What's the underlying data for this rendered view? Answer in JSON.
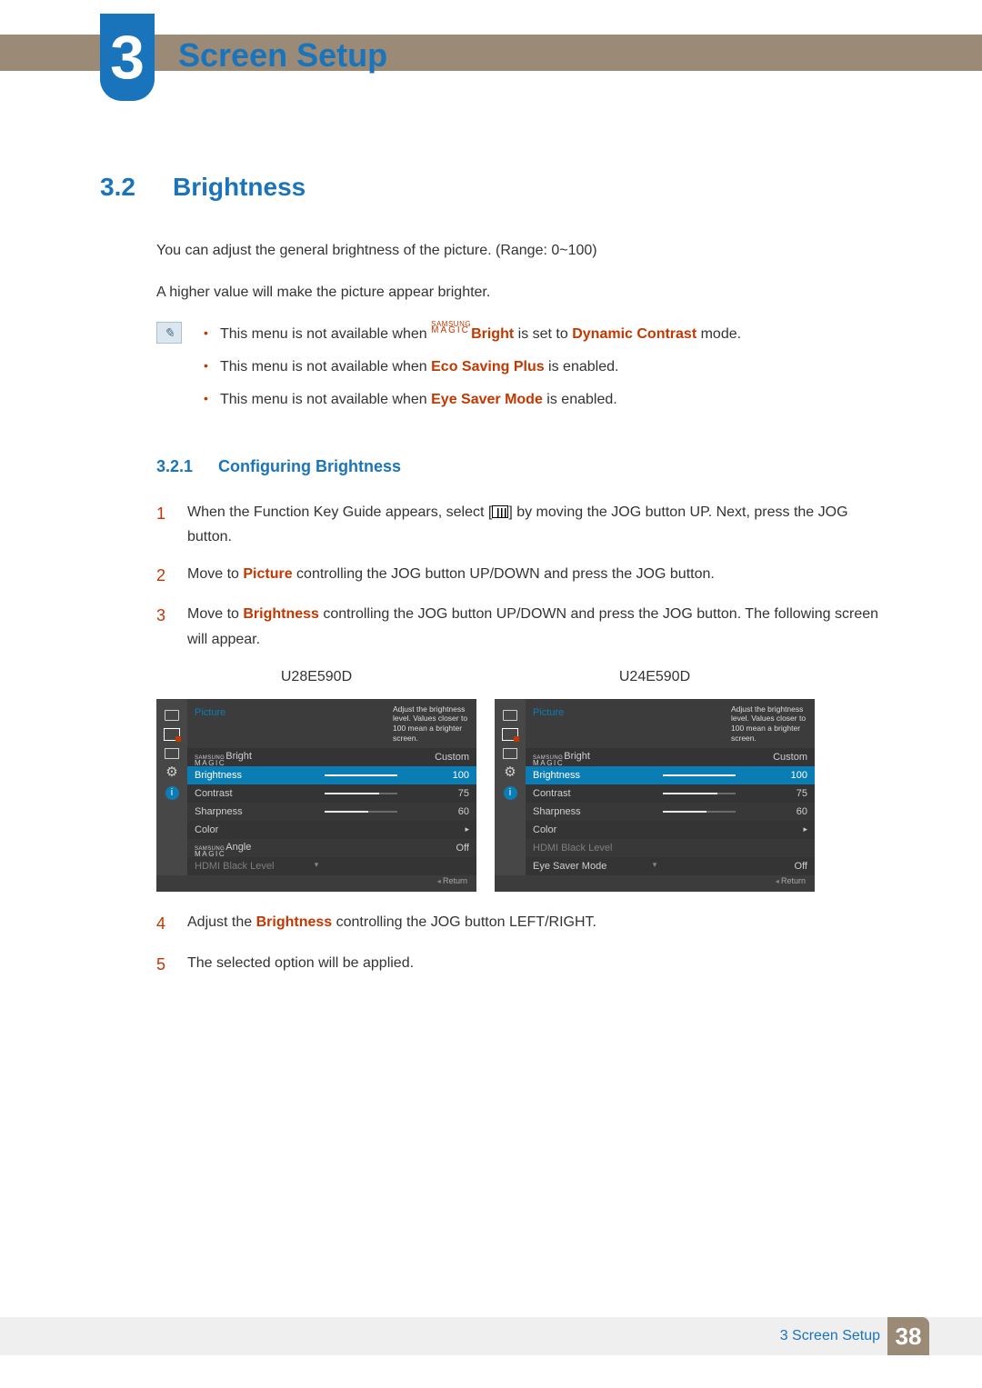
{
  "chapter": {
    "number": "3",
    "title": "Screen Setup"
  },
  "section": {
    "number": "3.2",
    "title": "Brightness",
    "intro1": "You can adjust the general brightness of the picture. (Range: 0~100)",
    "intro2": "A higher value will make the picture appear brighter."
  },
  "notes": {
    "n1_prefix": "This menu is not available when ",
    "n1_magic_top": "SAMSUNG",
    "n1_magic_bot": "MAGIC",
    "n1_bright": "Bright",
    "n1_mid": " is set to ",
    "n1_em": "Dynamic Contrast",
    "n1_suffix": " mode.",
    "n2_prefix": "This menu is not available when ",
    "n2_em": "Eco Saving Plus",
    "n2_suffix": " is enabled.",
    "n3_prefix": "This menu is not available when ",
    "n3_em": "Eye Saver Mode",
    "n3_suffix": " is enabled."
  },
  "subsection": {
    "number": "3.2.1",
    "title": "Configuring Brightness"
  },
  "steps": {
    "s1n": "1",
    "s1a": "When the Function Key Guide appears, select ",
    "s1b": " by moving the JOG button UP. Next, press the JOG button.",
    "s2n": "2",
    "s2a": "Move to ",
    "s2em": "Picture",
    "s2b": " controlling the JOG button UP/DOWN and press the JOG button.",
    "s3n": "3",
    "s3a": "Move to ",
    "s3em": "Brightness",
    "s3b": " controlling the JOG button UP/DOWN and press the JOG button. The following screen will appear.",
    "s4n": "4",
    "s4a": "Adjust the ",
    "s4em": "Brightness",
    "s4b": " controlling the JOG button LEFT/RIGHT.",
    "s5n": "5",
    "s5a": "The selected option will be applied."
  },
  "osd": {
    "left_caption": "U28E590D",
    "right_caption": "U24E590D",
    "menu_title": "Picture",
    "help_text": "Adjust the brightness level. Values closer to 100 mean a brighter screen.",
    "return_label": "Return",
    "magic_top": "SAMSUNG",
    "magic_bot": "MAGIC",
    "left_items": [
      {
        "label_suffix": "Bright",
        "value": "Custom",
        "magic": true
      },
      {
        "label": "Brightness",
        "value": "100",
        "slider": 100,
        "selected": true
      },
      {
        "label": "Contrast",
        "value": "75",
        "slider": 75
      },
      {
        "label": "Sharpness",
        "value": "60",
        "slider": 60
      },
      {
        "label": "Color",
        "arrow": true
      },
      {
        "label_suffix": "Angle",
        "value": "Off",
        "magic": true
      },
      {
        "label": "HDMI Black Level",
        "dim": true
      }
    ],
    "right_items": [
      {
        "label_suffix": "Bright",
        "value": "Custom",
        "magic": true
      },
      {
        "label": "Brightness",
        "value": "100",
        "slider": 100,
        "selected": true
      },
      {
        "label": "Contrast",
        "value": "75",
        "slider": 75
      },
      {
        "label": "Sharpness",
        "value": "60",
        "slider": 60
      },
      {
        "label": "Color",
        "arrow": true
      },
      {
        "label": "HDMI Black Level",
        "dim": true
      },
      {
        "label": "Eye Saver Mode",
        "value": "Off"
      }
    ]
  },
  "footer": {
    "label": "3 Screen Setup",
    "page": "38"
  }
}
